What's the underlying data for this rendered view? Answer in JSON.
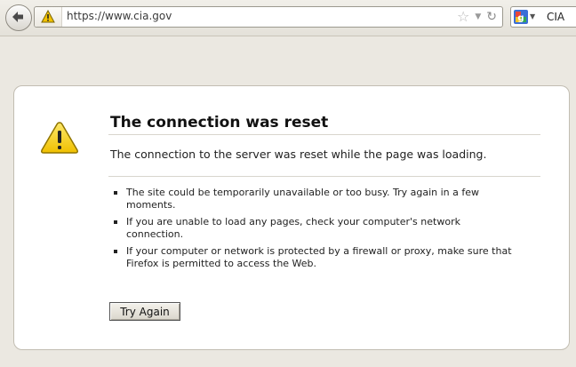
{
  "toolbar": {
    "url": "https://www.cia.gov",
    "search_text": "CIA",
    "icons": {
      "back": "back-arrow-icon",
      "site_identity": "warning-triangle-icon",
      "bookmark": "star-icon",
      "history_dropmarker": "dropmarker-icon",
      "reload": "reload-icon",
      "search_engine": "google-icon",
      "search_engine_dropdown": "chevron-down-icon"
    }
  },
  "error": {
    "icon": "warning-icon",
    "title": "The connection was reset",
    "description": "The connection to the server was reset while the page was loading.",
    "bullets": [
      [
        "The site could be temporarily unavailable or too busy. Try again in a few",
        "moments."
      ],
      [
        "If you are unable to load any pages, check your computer's network",
        "connection."
      ],
      [
        "If your computer or network is protected by a firewall or proxy, make sure that",
        "Firefox is permitted to access the Web."
      ]
    ],
    "button_label": "Try Again"
  },
  "colors": {
    "chrome_bg": "#ebe8e1",
    "card_bg": "#ffffff",
    "warning_yellow": "#f7d21e"
  }
}
